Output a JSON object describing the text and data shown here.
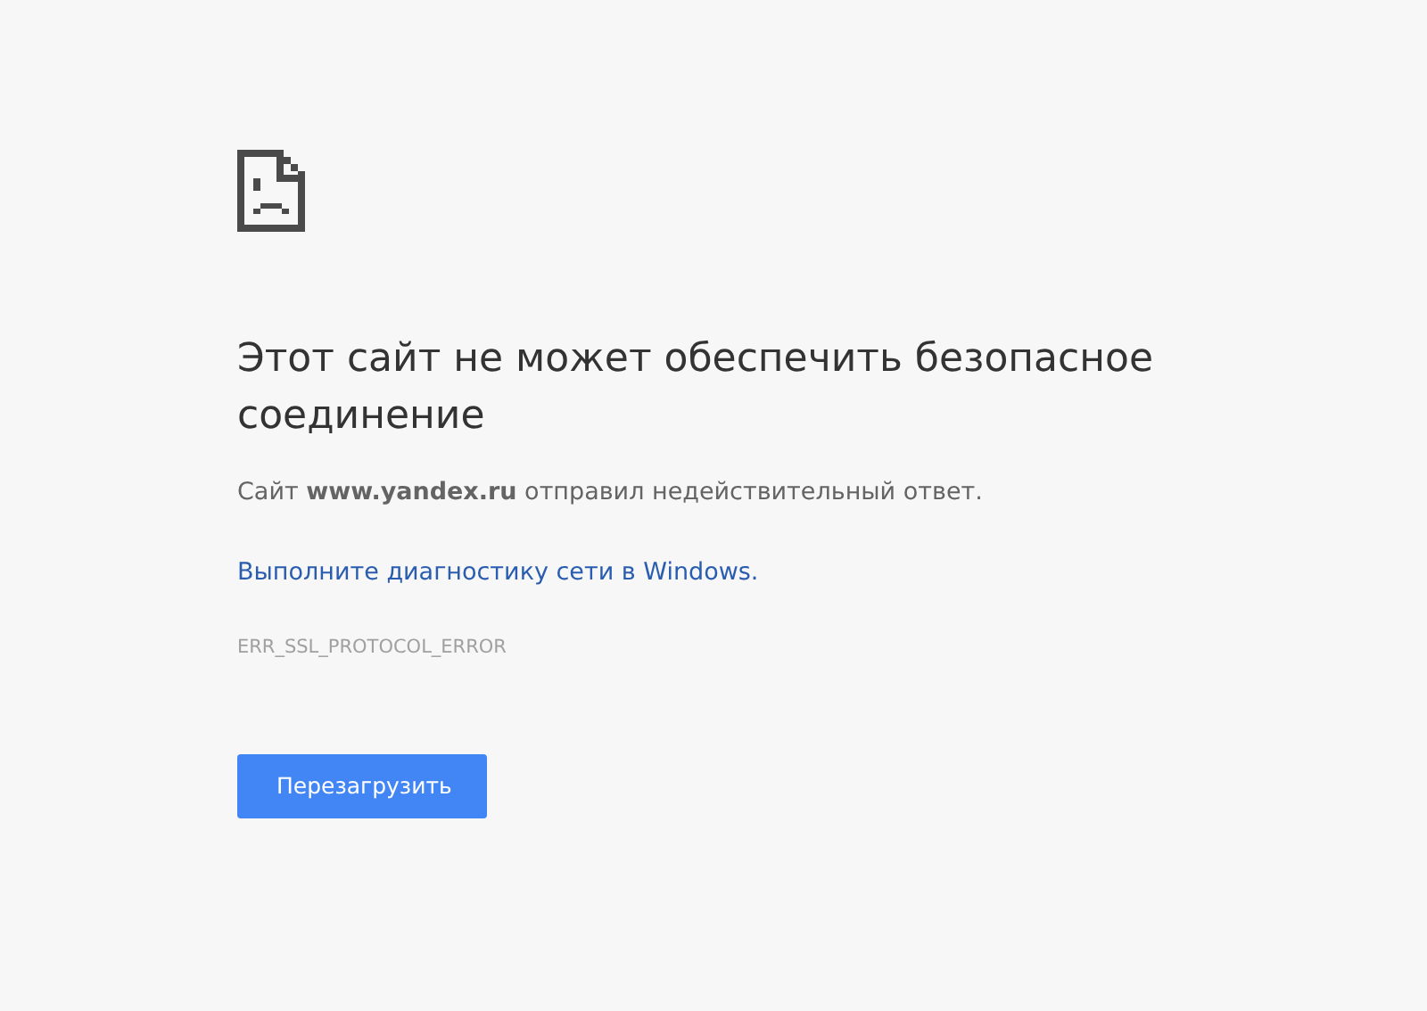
{
  "heading": "Этот сайт не может обеспечить безопасное соединение",
  "message": "Сайт **www.yandex.ru** отправил недействительный ответ.",
  "link": "Выполните диагностику сети в Windows.",
  "error_code": "ERR_SSL_PROTOCOL_ERROR",
  "button": "Перезагрузить"
}
